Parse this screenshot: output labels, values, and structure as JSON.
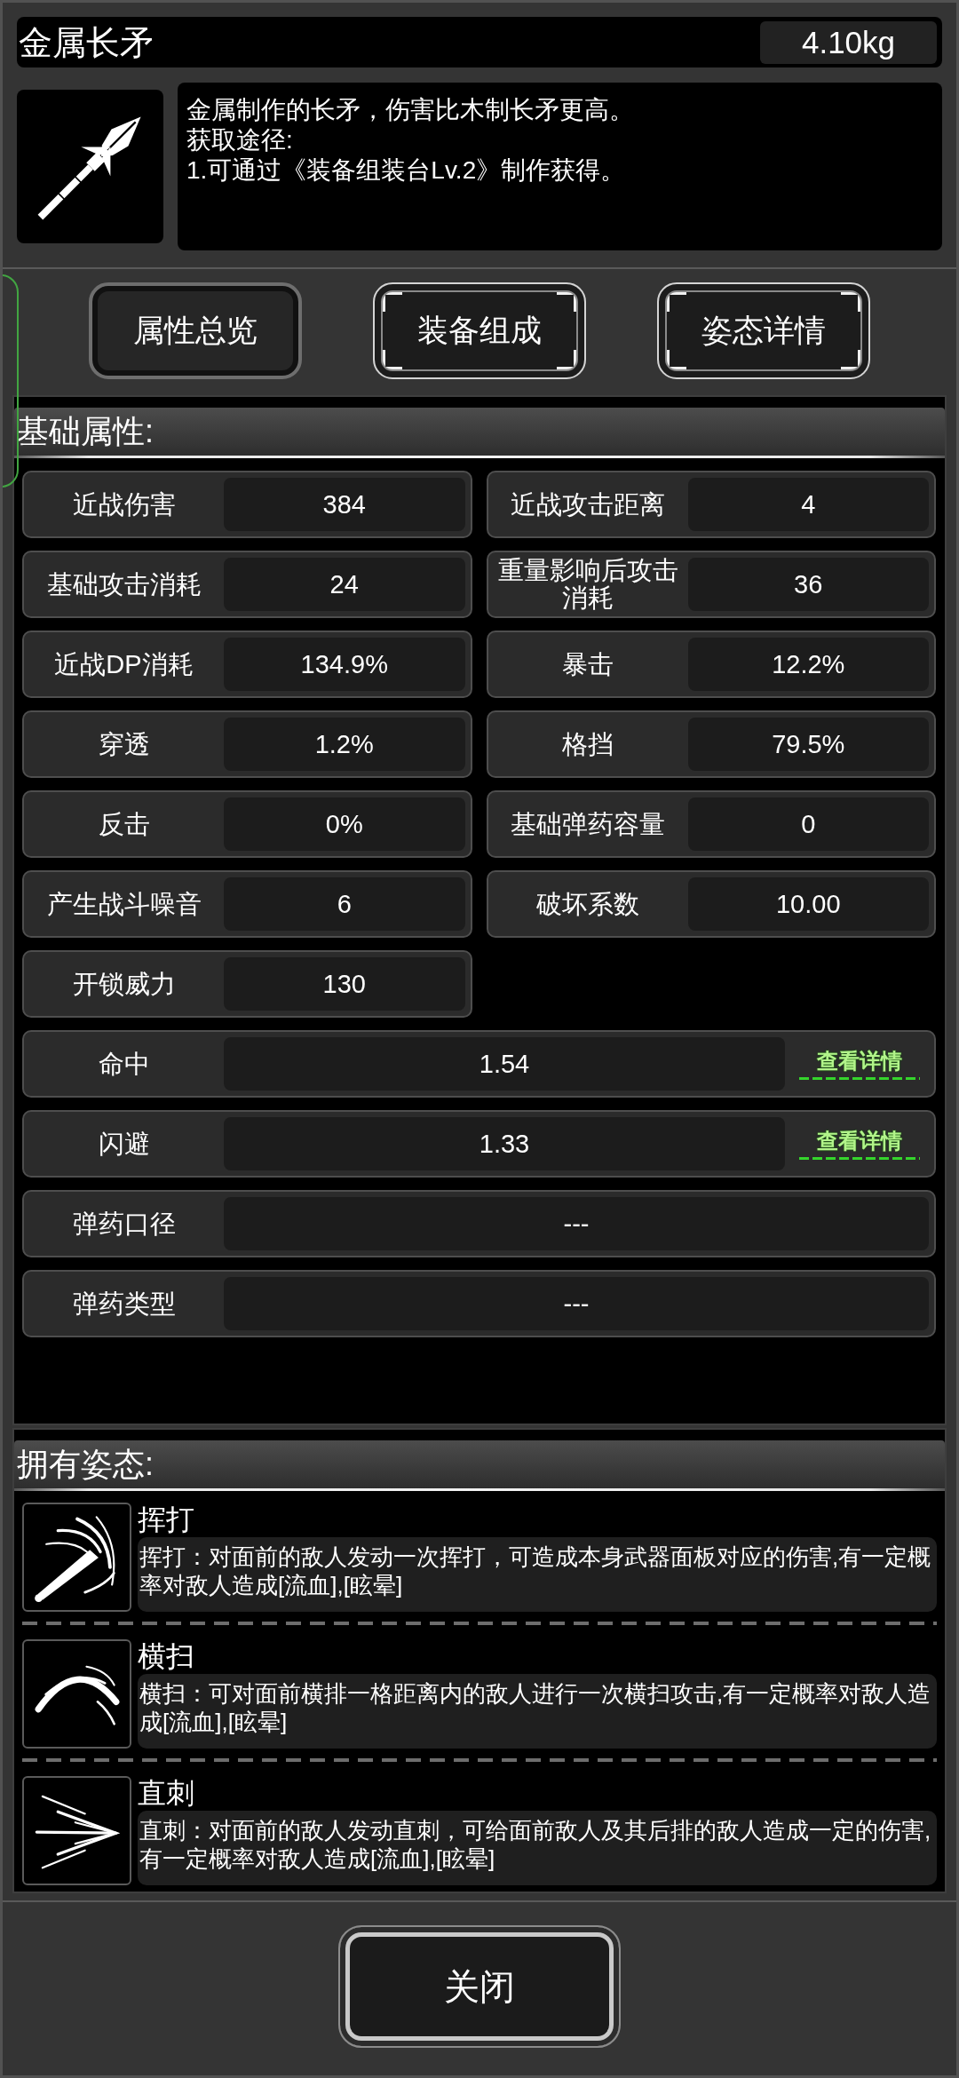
{
  "header": {
    "name": "金属长矛",
    "weight": "4.10kg",
    "description": [
      "金属制作的长矛，伤害比木制长矛更高。",
      "获取途径:",
      "1.可通过《装备组装台Lv.2》制作获得。"
    ]
  },
  "tabs": [
    {
      "label": "属性总览",
      "selected": true
    },
    {
      "label": "装备组成",
      "selected": false
    },
    {
      "label": "姿态详情",
      "selected": false
    }
  ],
  "basic_attributes": {
    "title": "基础属性:",
    "stats": [
      {
        "label": "近战伤害",
        "value": "384",
        "kind": "half"
      },
      {
        "label": "近战攻击距离",
        "value": "4",
        "kind": "half"
      },
      {
        "label": "基础攻击消耗",
        "value": "24",
        "kind": "half"
      },
      {
        "label": "重量影响后攻击消耗",
        "value": "36",
        "kind": "half"
      },
      {
        "label": "近战DP消耗",
        "value": "134.9%",
        "kind": "half"
      },
      {
        "label": "暴击",
        "value": "12.2%",
        "kind": "half"
      },
      {
        "label": "穿透",
        "value": "1.2%",
        "kind": "half"
      },
      {
        "label": "格挡",
        "value": "79.5%",
        "kind": "half"
      },
      {
        "label": "反击",
        "value": "0%",
        "kind": "half"
      },
      {
        "label": "基础弹药容量",
        "value": "0",
        "kind": "half"
      },
      {
        "label": "产生战斗噪音",
        "value": "6",
        "kind": "half"
      },
      {
        "label": "破坏系数",
        "value": "10.00",
        "kind": "half"
      },
      {
        "label": "开锁威力",
        "value": "130",
        "kind": "half"
      },
      {
        "label": "命中",
        "value": "1.54",
        "kind": "wide",
        "link": "查看详情"
      },
      {
        "label": "闪避",
        "value": "1.33",
        "kind": "wide",
        "link": "查看详情"
      },
      {
        "label": "弹药口径",
        "value": "---",
        "kind": "wide"
      },
      {
        "label": "弹药类型",
        "value": "---",
        "kind": "wide"
      }
    ]
  },
  "stances": {
    "title": "拥有姿态:",
    "items": [
      {
        "name": "挥打",
        "kind": "swing",
        "description": "挥打：对面前的敌人发动一次挥打，可造成本身武器面板对应的伤害,有一定概率对敌人造成[流血],[眩晕]"
      },
      {
        "name": "横扫",
        "kind": "sweep",
        "description": "横扫：可对面前横排一格距离内的敌人进行一次横扫攻击,有一定概率对敌人造成[流血],[眩晕]"
      },
      {
        "name": "直刺",
        "kind": "thrust",
        "description": "直刺：对面前的敌人发动直刺，可给面前敌人及其后排的敌人造成一定的伤害,有一定概率对敌人造成[流血],[眩晕]"
      }
    ]
  },
  "close_button": "关闭"
}
